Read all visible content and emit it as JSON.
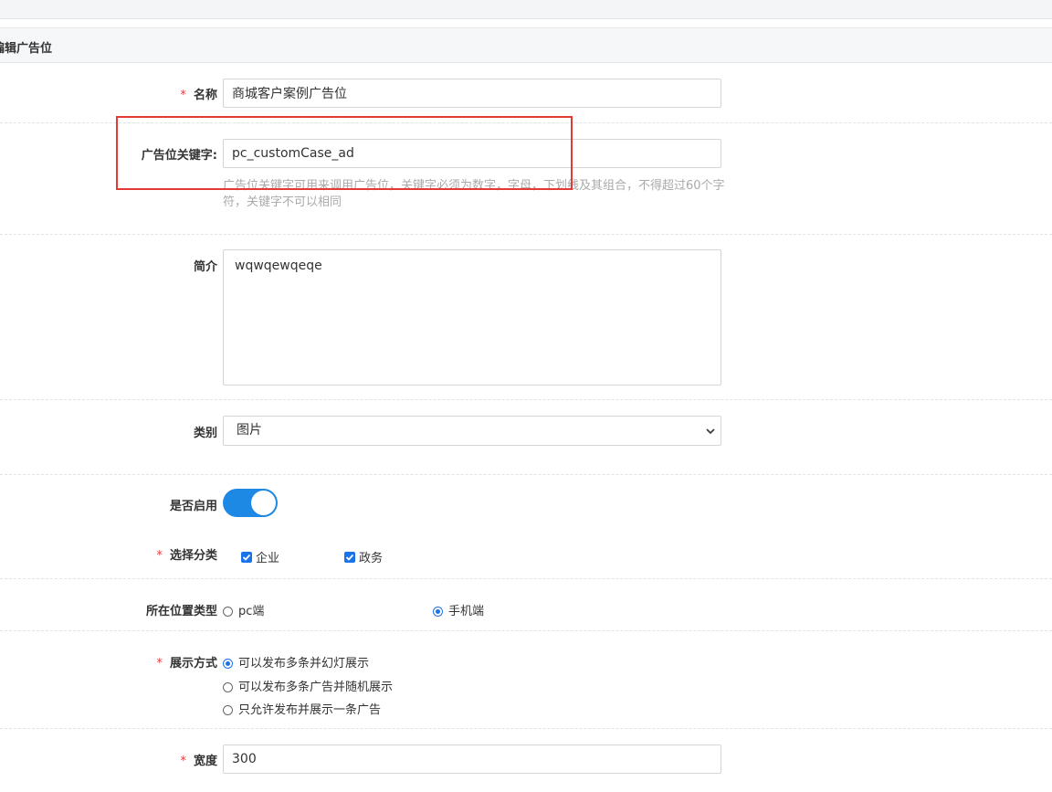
{
  "panel": {
    "title": "编辑广告位"
  },
  "form": {
    "name": {
      "label": "名称",
      "required_mark": "*",
      "value": "商城客户案例广告位"
    },
    "keyword": {
      "label": "广告位关键字:",
      "value": "pc_customCase_ad",
      "help": "广告位关键字可用来调用广告位，关键字必须为数字，字母，下划线及其组合，不得超过60个字符，关键字不可以相同"
    },
    "intro": {
      "label": "简介",
      "value": "wqwqewqeqe"
    },
    "category": {
      "label": "类别",
      "selected": "图片"
    },
    "enabled": {
      "label": "是否启用",
      "on": true
    },
    "classify": {
      "label": "选择分类",
      "required_mark": "*",
      "options": [
        {
          "label": "企业",
          "checked": true
        },
        {
          "label": "政务",
          "checked": true
        }
      ]
    },
    "position_type": {
      "label": "所在位置类型",
      "options": [
        {
          "label": "pc端",
          "selected": false
        },
        {
          "label": "手机端",
          "selected": true
        }
      ]
    },
    "display_mode": {
      "label": "展示方式",
      "required_mark": "*",
      "options": [
        {
          "label": "可以发布多条并幻灯展示",
          "selected": true
        },
        {
          "label": "可以发布多条广告并随机展示",
          "selected": false
        },
        {
          "label": "只允许发布并展示一条广告",
          "selected": false
        }
      ]
    },
    "width": {
      "label": "宽度",
      "required_mark": "*",
      "value": "300"
    }
  },
  "colors": {
    "accent": "#1a73e8",
    "highlight": "#e53935",
    "required": "#e4393c"
  }
}
